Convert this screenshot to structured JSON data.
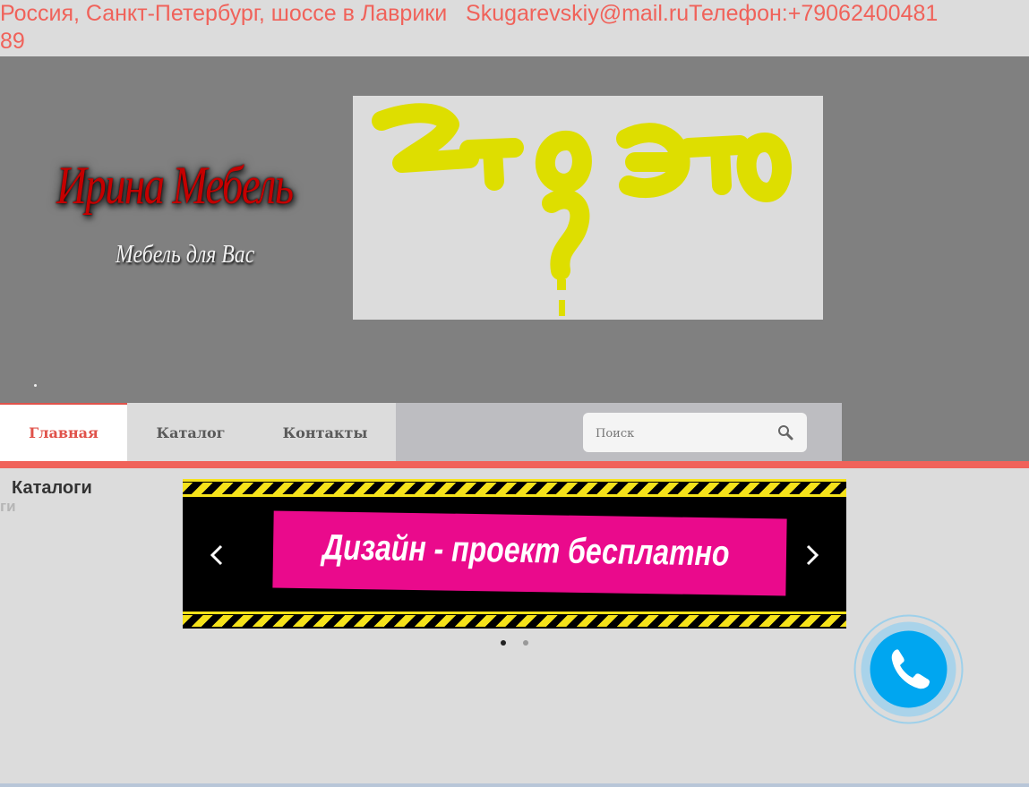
{
  "topbar": {
    "address": "Россия, Санкт-Петербург, шоссе в Лаврики",
    "email": "Skugarevskiy@mail.ru",
    "phone_label": "Телефон:+79062400481",
    "phone_tail": "89"
  },
  "logo": {
    "title": "Ирина Мебель",
    "subtitle": "Мебель для Вас"
  },
  "nav": {
    "items": [
      {
        "label": "Главная"
      },
      {
        "label": "Каталог"
      },
      {
        "label": "Контакты"
      }
    ],
    "search_placeholder": "Поиск"
  },
  "sidebar": {
    "heading": "Каталоги",
    "ghost": "ги"
  },
  "slider": {
    "slide_text": "Дизайн - проект бесплатно",
    "active_index": 0,
    "slide_count": 2
  },
  "colors": {
    "accent": "#f0625a",
    "pink": "#ea0a8c",
    "call": "#00a6f0"
  },
  "icons": [
    "search-icon",
    "chevron-left-icon",
    "chevron-right-icon",
    "phone-icon"
  ]
}
